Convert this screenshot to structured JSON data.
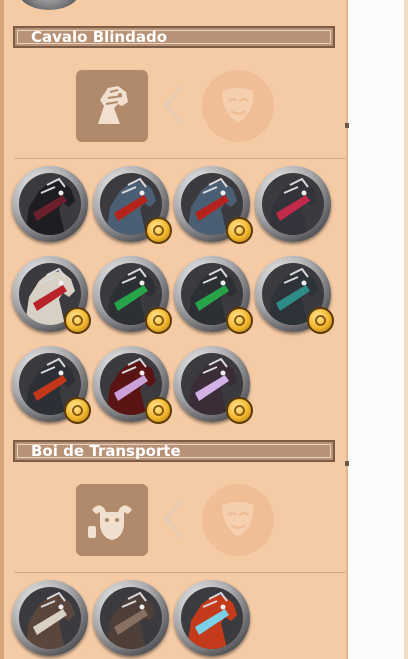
{
  "sections": [
    {
      "title": "Cavalo Blindado",
      "requirement_icon": "armored-horse-icon",
      "arrow_icon": "chevron-left-icon",
      "locked_icon": "mask-icon",
      "mounts": [
        {
          "name": "black-horse",
          "colors": [
            "#1e1e22",
            "#6b1f2a"
          ],
          "premium": false
        },
        {
          "name": "blue-armored-horse",
          "colors": [
            "#4b5f74",
            "#b4241c"
          ],
          "premium": true
        },
        {
          "name": "blue-armored-horse-2",
          "colors": [
            "#4b5f74",
            "#b4241c"
          ],
          "premium": true
        },
        {
          "name": "spiked-dark-horse",
          "colors": [
            "#33343b",
            "#c22a4a"
          ],
          "premium": false
        },
        {
          "name": "white-gold-horse",
          "colors": [
            "#d8d0c4",
            "#b8242a"
          ],
          "premium": true
        },
        {
          "name": "green-gem-horse",
          "colors": [
            "#2c2f33",
            "#27a44a"
          ],
          "premium": true
        },
        {
          "name": "green-gem-horse-2",
          "colors": [
            "#2c2f33",
            "#27a44a"
          ],
          "premium": true
        },
        {
          "name": "teal-cloth-horse",
          "colors": [
            "#2e3339",
            "#2e8c86"
          ],
          "premium": true
        },
        {
          "name": "blue-crest-horse",
          "colors": [
            "#2c2f35",
            "#c2371a"
          ],
          "premium": true
        },
        {
          "name": "red-crest-horse",
          "colors": [
            "#5a1414",
            "#caa2d8"
          ],
          "premium": true
        },
        {
          "name": "lilac-crest-horse",
          "colors": [
            "#3a2d38",
            "#d4b1e6"
          ],
          "premium": true
        }
      ]
    },
    {
      "title": "Boi de Transporte",
      "requirement_icon": "ox-icon",
      "arrow_icon": "chevron-left-icon",
      "locked_icon": "mask-icon",
      "mounts": [
        {
          "name": "brown-ox",
          "colors": [
            "#5b463c",
            "#d9d2c2"
          ],
          "premium": false
        },
        {
          "name": "shaggy-ox",
          "colors": [
            "#4e3f38",
            "#8a7060"
          ],
          "premium": false
        },
        {
          "name": "spirit-ox",
          "colors": [
            "#c53a1a",
            "#7ad0e6"
          ],
          "premium": false
        }
      ]
    }
  ]
}
